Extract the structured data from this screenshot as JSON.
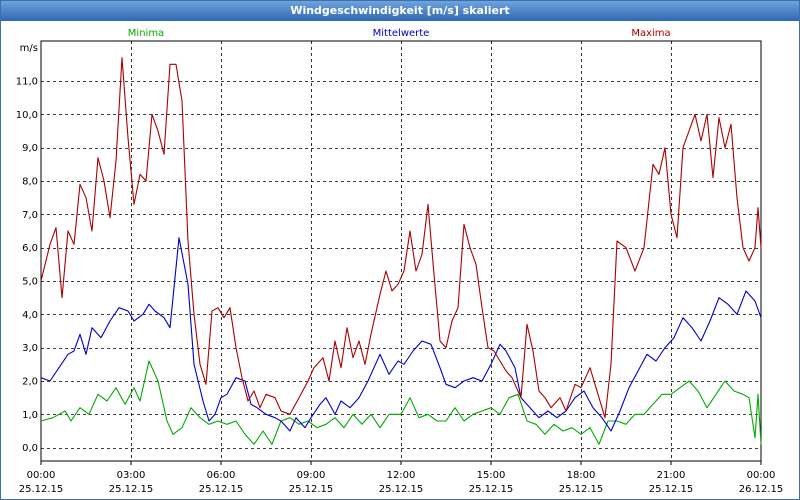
{
  "window": {
    "title": "Windgeschwindigkeit [m/s] skaliert"
  },
  "chart_data": {
    "type": "line",
    "title": "Windgeschwindigkeit [m/s] skaliert",
    "ylabel": "m/s",
    "xlabel": "",
    "ylim": [
      -0.4,
      12.2
    ],
    "xlim": [
      0,
      24
    ],
    "yticks": [
      0,
      1,
      2,
      3,
      4,
      5,
      6,
      7,
      8,
      9,
      10,
      11
    ],
    "ytick_labels": [
      "0,0",
      "1,0",
      "2,0",
      "3,0",
      "4,0",
      "5,0",
      "6,0",
      "7,0",
      "8,0",
      "9,0",
      "10,0",
      "11,0"
    ],
    "xticks": [
      0,
      3,
      6,
      9,
      12,
      15,
      18,
      21,
      24
    ],
    "xtick_labels": [
      [
        "00:00",
        "25.12.15"
      ],
      [
        "03:00",
        "25.12.15"
      ],
      [
        "06:00",
        "25.12.15"
      ],
      [
        "09:00",
        "25.12.15"
      ],
      [
        "12:00",
        "25.12.15"
      ],
      [
        "15:00",
        "25.12.15"
      ],
      [
        "18:00",
        "25.12.15"
      ],
      [
        "21:00",
        "25.12.15"
      ],
      [
        "00:00",
        "26.12.15"
      ]
    ],
    "grid": true,
    "legend_position": "top",
    "series": [
      {
        "name": "Minima",
        "color": "#00aa00",
        "points": [
          [
            0,
            0.8
          ],
          [
            0.4,
            0.9
          ],
          [
            0.8,
            1.1
          ],
          [
            1.0,
            0.8
          ],
          [
            1.3,
            1.2
          ],
          [
            1.6,
            1.0
          ],
          [
            1.9,
            1.6
          ],
          [
            2.2,
            1.4
          ],
          [
            2.5,
            1.8
          ],
          [
            2.8,
            1.3
          ],
          [
            3.1,
            1.8
          ],
          [
            3.3,
            1.4
          ],
          [
            3.6,
            2.6
          ],
          [
            3.9,
            2.0
          ],
          [
            4.2,
            0.8
          ],
          [
            4.4,
            0.4
          ],
          [
            4.7,
            0.6
          ],
          [
            5.0,
            1.2
          ],
          [
            5.3,
            0.9
          ],
          [
            5.6,
            0.7
          ],
          [
            5.9,
            0.8
          ],
          [
            6.2,
            0.7
          ],
          [
            6.5,
            0.8
          ],
          [
            6.8,
            0.4
          ],
          [
            7.1,
            0.1
          ],
          [
            7.4,
            0.5
          ],
          [
            7.7,
            0.1
          ],
          [
            8.0,
            0.8
          ],
          [
            8.3,
            0.9
          ],
          [
            8.6,
            0.7
          ],
          [
            8.9,
            0.8
          ],
          [
            9.2,
            0.6
          ],
          [
            9.5,
            0.7
          ],
          [
            9.8,
            0.9
          ],
          [
            10.1,
            0.6
          ],
          [
            10.4,
            1.0
          ],
          [
            10.7,
            0.7
          ],
          [
            11.0,
            1.0
          ],
          [
            11.3,
            0.6
          ],
          [
            11.6,
            1.0
          ],
          [
            12.0,
            1.0
          ],
          [
            12.3,
            1.5
          ],
          [
            12.6,
            0.9
          ],
          [
            12.9,
            1.0
          ],
          [
            13.2,
            0.8
          ],
          [
            13.5,
            0.8
          ],
          [
            13.8,
            1.2
          ],
          [
            14.1,
            0.8
          ],
          [
            14.4,
            1.0
          ],
          [
            14.7,
            1.1
          ],
          [
            15.0,
            1.2
          ],
          [
            15.3,
            1.0
          ],
          [
            15.6,
            1.5
          ],
          [
            15.9,
            1.6
          ],
          [
            16.2,
            0.8
          ],
          [
            16.5,
            0.7
          ],
          [
            16.8,
            0.4
          ],
          [
            17.1,
            0.7
          ],
          [
            17.4,
            0.5
          ],
          [
            17.7,
            0.6
          ],
          [
            18.0,
            0.4
          ],
          [
            18.3,
            0.6
          ],
          [
            18.6,
            0.1
          ],
          [
            18.9,
            0.8
          ],
          [
            19.2,
            0.8
          ],
          [
            19.5,
            0.7
          ],
          [
            19.8,
            1.0
          ],
          [
            20.1,
            1.0
          ],
          [
            20.4,
            1.3
          ],
          [
            20.7,
            1.6
          ],
          [
            21.0,
            1.6
          ],
          [
            21.3,
            1.8
          ],
          [
            21.6,
            2.0
          ],
          [
            21.9,
            1.7
          ],
          [
            22.2,
            1.2
          ],
          [
            22.5,
            1.6
          ],
          [
            22.8,
            2.0
          ],
          [
            23.1,
            1.7
          ],
          [
            23.4,
            1.6
          ],
          [
            23.6,
            1.5
          ],
          [
            23.8,
            0.3
          ],
          [
            23.9,
            1.6
          ],
          [
            24.0,
            0.1
          ]
        ]
      },
      {
        "name": "Mittelwerte",
        "color": "#0000cc",
        "points": [
          [
            0,
            2.1
          ],
          [
            0.3,
            2.0
          ],
          [
            0.6,
            2.4
          ],
          [
            0.9,
            2.8
          ],
          [
            1.1,
            2.9
          ],
          [
            1.3,
            3.4
          ],
          [
            1.5,
            2.8
          ],
          [
            1.7,
            3.6
          ],
          [
            2.0,
            3.3
          ],
          [
            2.3,
            3.8
          ],
          [
            2.6,
            4.2
          ],
          [
            2.9,
            4.1
          ],
          [
            3.1,
            3.8
          ],
          [
            3.4,
            4.0
          ],
          [
            3.6,
            4.3
          ],
          [
            3.8,
            4.1
          ],
          [
            4.1,
            3.9
          ],
          [
            4.3,
            3.6
          ],
          [
            4.6,
            6.3
          ],
          [
            4.9,
            4.9
          ],
          [
            5.1,
            2.5
          ],
          [
            5.4,
            1.4
          ],
          [
            5.6,
            0.8
          ],
          [
            5.8,
            1.0
          ],
          [
            6.0,
            1.5
          ],
          [
            6.2,
            1.6
          ],
          [
            6.5,
            2.1
          ],
          [
            6.8,
            2.0
          ],
          [
            7.0,
            1.3
          ],
          [
            7.2,
            1.2
          ],
          [
            7.5,
            1.0
          ],
          [
            7.8,
            0.9
          ],
          [
            8.0,
            0.8
          ],
          [
            8.3,
            0.5
          ],
          [
            8.5,
            0.9
          ],
          [
            8.8,
            0.6
          ],
          [
            9.0,
            0.9
          ],
          [
            9.3,
            1.3
          ],
          [
            9.5,
            1.5
          ],
          [
            9.8,
            1.0
          ],
          [
            10.0,
            1.4
          ],
          [
            10.3,
            1.2
          ],
          [
            10.6,
            1.5
          ],
          [
            10.9,
            2.0
          ],
          [
            11.1,
            2.4
          ],
          [
            11.3,
            2.8
          ],
          [
            11.6,
            2.2
          ],
          [
            11.9,
            2.6
          ],
          [
            12.1,
            2.5
          ],
          [
            12.4,
            2.9
          ],
          [
            12.7,
            3.2
          ],
          [
            13.0,
            3.1
          ],
          [
            13.3,
            2.4
          ],
          [
            13.5,
            1.9
          ],
          [
            13.8,
            1.8
          ],
          [
            14.1,
            2.0
          ],
          [
            14.4,
            2.1
          ],
          [
            14.7,
            2.0
          ],
          [
            15.0,
            2.5
          ],
          [
            15.3,
            3.1
          ],
          [
            15.5,
            2.9
          ],
          [
            15.8,
            2.4
          ],
          [
            16.0,
            1.5
          ],
          [
            16.3,
            1.2
          ],
          [
            16.6,
            0.9
          ],
          [
            16.9,
            1.1
          ],
          [
            17.2,
            0.9
          ],
          [
            17.5,
            1.1
          ],
          [
            17.8,
            1.5
          ],
          [
            18.1,
            1.7
          ],
          [
            18.4,
            1.2
          ],
          [
            18.7,
            0.9
          ],
          [
            19.0,
            0.5
          ],
          [
            19.3,
            1.1
          ],
          [
            19.6,
            1.8
          ],
          [
            19.9,
            2.3
          ],
          [
            20.2,
            2.8
          ],
          [
            20.5,
            2.6
          ],
          [
            20.8,
            3.0
          ],
          [
            21.1,
            3.3
          ],
          [
            21.4,
            3.9
          ],
          [
            21.7,
            3.6
          ],
          [
            22.0,
            3.2
          ],
          [
            22.3,
            3.8
          ],
          [
            22.6,
            4.5
          ],
          [
            22.9,
            4.3
          ],
          [
            23.2,
            4.0
          ],
          [
            23.5,
            4.7
          ],
          [
            23.8,
            4.4
          ],
          [
            24.0,
            3.9
          ]
        ]
      },
      {
        "name": "Maxima",
        "color": "#aa0000",
        "points": [
          [
            0,
            5.0
          ],
          [
            0.3,
            6.1
          ],
          [
            0.5,
            6.6
          ],
          [
            0.7,
            4.5
          ],
          [
            0.9,
            6.5
          ],
          [
            1.1,
            6.1
          ],
          [
            1.3,
            7.9
          ],
          [
            1.5,
            7.5
          ],
          [
            1.7,
            6.5
          ],
          [
            1.9,
            8.7
          ],
          [
            2.1,
            8.0
          ],
          [
            2.3,
            6.9
          ],
          [
            2.5,
            8.6
          ],
          [
            2.7,
            11.7
          ],
          [
            2.9,
            9.3
          ],
          [
            3.1,
            7.3
          ],
          [
            3.3,
            8.2
          ],
          [
            3.5,
            8.0
          ],
          [
            3.7,
            10.0
          ],
          [
            3.9,
            9.5
          ],
          [
            4.1,
            8.8
          ],
          [
            4.3,
            11.5
          ],
          [
            4.5,
            11.5
          ],
          [
            4.7,
            10.4
          ],
          [
            4.9,
            6.2
          ],
          [
            5.1,
            4.0
          ],
          [
            5.3,
            2.5
          ],
          [
            5.5,
            1.9
          ],
          [
            5.7,
            4.1
          ],
          [
            5.9,
            4.2
          ],
          [
            6.1,
            3.9
          ],
          [
            6.3,
            4.2
          ],
          [
            6.5,
            3.0
          ],
          [
            6.7,
            2.1
          ],
          [
            6.9,
            1.4
          ],
          [
            7.1,
            1.7
          ],
          [
            7.3,
            1.2
          ],
          [
            7.5,
            1.6
          ],
          [
            7.8,
            1.5
          ],
          [
            8.0,
            1.1
          ],
          [
            8.3,
            1.0
          ],
          [
            8.6,
            1.5
          ],
          [
            8.9,
            2.0
          ],
          [
            9.1,
            2.4
          ],
          [
            9.4,
            2.7
          ],
          [
            9.6,
            2.0
          ],
          [
            9.8,
            3.2
          ],
          [
            10.0,
            2.4
          ],
          [
            10.2,
            3.6
          ],
          [
            10.4,
            2.7
          ],
          [
            10.6,
            3.2
          ],
          [
            10.8,
            2.5
          ],
          [
            11.0,
            3.4
          ],
          [
            11.3,
            4.6
          ],
          [
            11.5,
            5.3
          ],
          [
            11.7,
            4.7
          ],
          [
            11.9,
            4.9
          ],
          [
            12.1,
            5.3
          ],
          [
            12.3,
            6.5
          ],
          [
            12.5,
            5.3
          ],
          [
            12.7,
            5.8
          ],
          [
            12.9,
            7.3
          ],
          [
            13.1,
            5.2
          ],
          [
            13.3,
            3.2
          ],
          [
            13.5,
            3.0
          ],
          [
            13.7,
            3.8
          ],
          [
            13.9,
            4.2
          ],
          [
            14.1,
            6.7
          ],
          [
            14.3,
            6.0
          ],
          [
            14.5,
            5.5
          ],
          [
            14.7,
            4.2
          ],
          [
            14.9,
            3.0
          ],
          [
            15.1,
            2.9
          ],
          [
            15.3,
            2.6
          ],
          [
            15.5,
            2.3
          ],
          [
            15.7,
            2.1
          ],
          [
            16.0,
            1.5
          ],
          [
            16.2,
            3.7
          ],
          [
            16.4,
            2.9
          ],
          [
            16.6,
            1.7
          ],
          [
            16.8,
            1.5
          ],
          [
            17.0,
            1.2
          ],
          [
            17.3,
            1.5
          ],
          [
            17.5,
            1.1
          ],
          [
            17.8,
            1.9
          ],
          [
            18.0,
            1.8
          ],
          [
            18.3,
            2.4
          ],
          [
            18.6,
            1.5
          ],
          [
            18.8,
            0.9
          ],
          [
            19.0,
            2.5
          ],
          [
            19.2,
            6.2
          ],
          [
            19.5,
            6.0
          ],
          [
            19.8,
            5.3
          ],
          [
            20.1,
            6.0
          ],
          [
            20.4,
            8.5
          ],
          [
            20.6,
            8.2
          ],
          [
            20.8,
            9.0
          ],
          [
            21.0,
            7.0
          ],
          [
            21.2,
            6.3
          ],
          [
            21.4,
            9.0
          ],
          [
            21.6,
            9.5
          ],
          [
            21.8,
            10.0
          ],
          [
            22.0,
            9.2
          ],
          [
            22.2,
            10.0
          ],
          [
            22.4,
            8.1
          ],
          [
            22.6,
            9.9
          ],
          [
            22.8,
            9.0
          ],
          [
            23.0,
            9.7
          ],
          [
            23.2,
            7.5
          ],
          [
            23.4,
            6.0
          ],
          [
            23.6,
            5.6
          ],
          [
            23.8,
            6.0
          ],
          [
            23.9,
            7.2
          ],
          [
            24.0,
            6.0
          ]
        ]
      }
    ]
  }
}
